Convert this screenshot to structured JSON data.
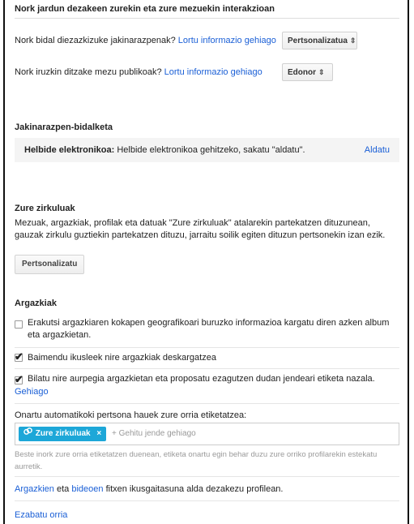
{
  "header": {
    "title": "Nork jardun dezakeen zurekin eta zure mezuekin interakzioan"
  },
  "notifications_row": {
    "text": "Nork bidal diezazkizuke jakinarazpenak?",
    "link": "Lortu informazio gehiago",
    "select_value": "Pertsonalizatua"
  },
  "comments_row": {
    "text": "Nork iruzkin ditzake mezu publikoak?",
    "link": "Lortu informazio gehiago",
    "select_value": "Edonor"
  },
  "delivery": {
    "title": "Jakinarazpen-bidalketa",
    "email_label": "Helbide elektronikoa:",
    "email_text": "Helbide elektronikoa gehitzeko, sakatu \"aldatu\".",
    "change_link": "Aldatu"
  },
  "circles": {
    "title": "Zure zirkuluak",
    "description": "Mezuak, argazkiak, profilak eta datuak \"Zure zirkuluak\" atalarekin partekatzen dituzunean, gauzak zirkulu guztiekin partekatzen dituzu, jarraitu soilik egiten dituzun pertsonekin izan ezik.",
    "button": "Pertsonalizatu"
  },
  "photos": {
    "title": "Argazkiak",
    "options": [
      {
        "checked": false,
        "text": "Erakutsi argazkiaren kokapen geografikoari buruzko informazioa kargatu diren azken album eta argazkietan."
      },
      {
        "checked": true,
        "text": "Baimendu ikusleek nire argazkiak deskargatzea"
      },
      {
        "checked": true,
        "text": "Bilatu nire aurpegia argazkietan eta proposatu ezagutzen dudan jendeari etiketa nazala.",
        "link": "Gehiago"
      }
    ],
    "auto_tag_label": "Onartu automatikoki pertsona hauek zure orria etiketatzea:",
    "chip_label": "Zure zirkuluak",
    "chip_close": "×",
    "add_placeholder": "+ Gehitu jende gehiago",
    "hint": "Beste inork zure orria etiketatzen duenean, etiketa onartu egin behar duzu zure orriko profilarekin estekatu aurretik."
  },
  "visibility": {
    "link1": "Argazkien",
    "middle": "eta",
    "link2": "bideoen",
    "rest": "fitxen ikusgaitasuna alda dezakezu profilean."
  },
  "delete_link": "Ezabatu orria"
}
